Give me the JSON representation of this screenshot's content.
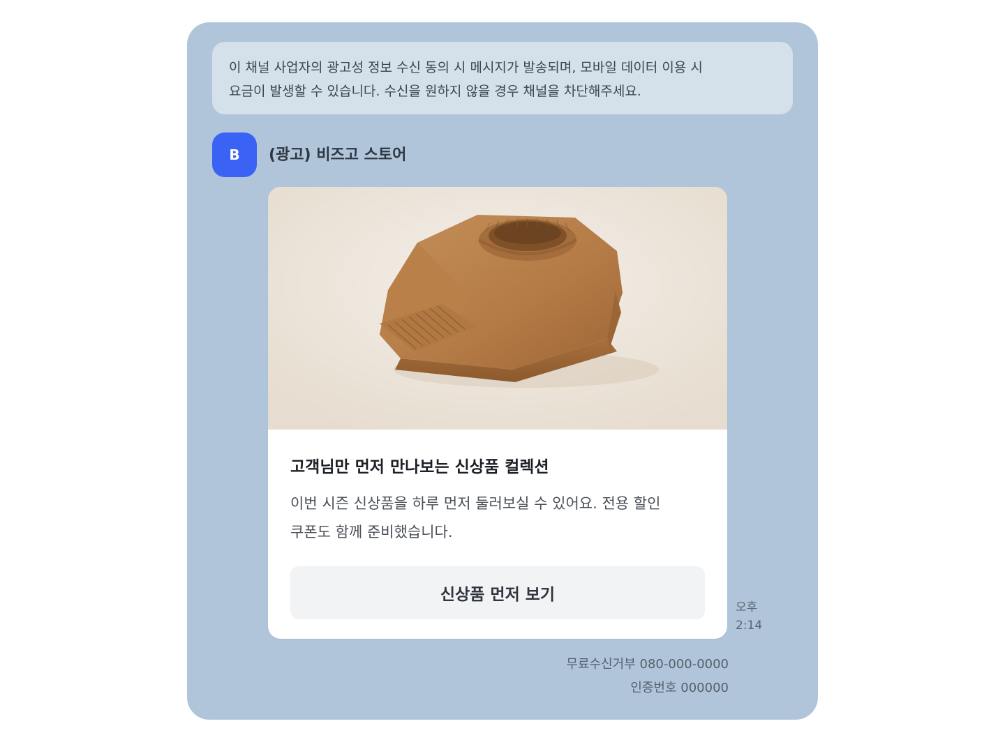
{
  "notice": {
    "text": "이 채널 사업자의 광고성 정보 수신 동의 시 메시지가 발송되며, 모바일 데이터 이용 시\n요금이 발생할 수 있습니다. 수신을 원하지 않을 경우 채널을 차단해주세요."
  },
  "sender": {
    "avatar_letter": "B",
    "name": "(광고) 비즈고 스토어",
    "avatar_color": "#3a63f5"
  },
  "card": {
    "image_icon": "folded-sweater-image",
    "title": "고객님만 먼저 만나보는 신상품 컬렉션",
    "description": "이번 시즌 신상품을 하루 먼저 둘러보실 수 있어요. 전용 할인\n쿠폰도 함께 준비했습니다.",
    "button_label": "신상품 먼저 보기"
  },
  "message_time": {
    "period": "오후",
    "time": "2:14"
  },
  "footer": {
    "opt_out": "무료수신거부 080-000-0000",
    "auth_code": "인증번호 000000"
  },
  "colors": {
    "chat_background": "#b0c5da",
    "notice_background": "#d4e0ea",
    "button_background": "#f2f3f5"
  }
}
